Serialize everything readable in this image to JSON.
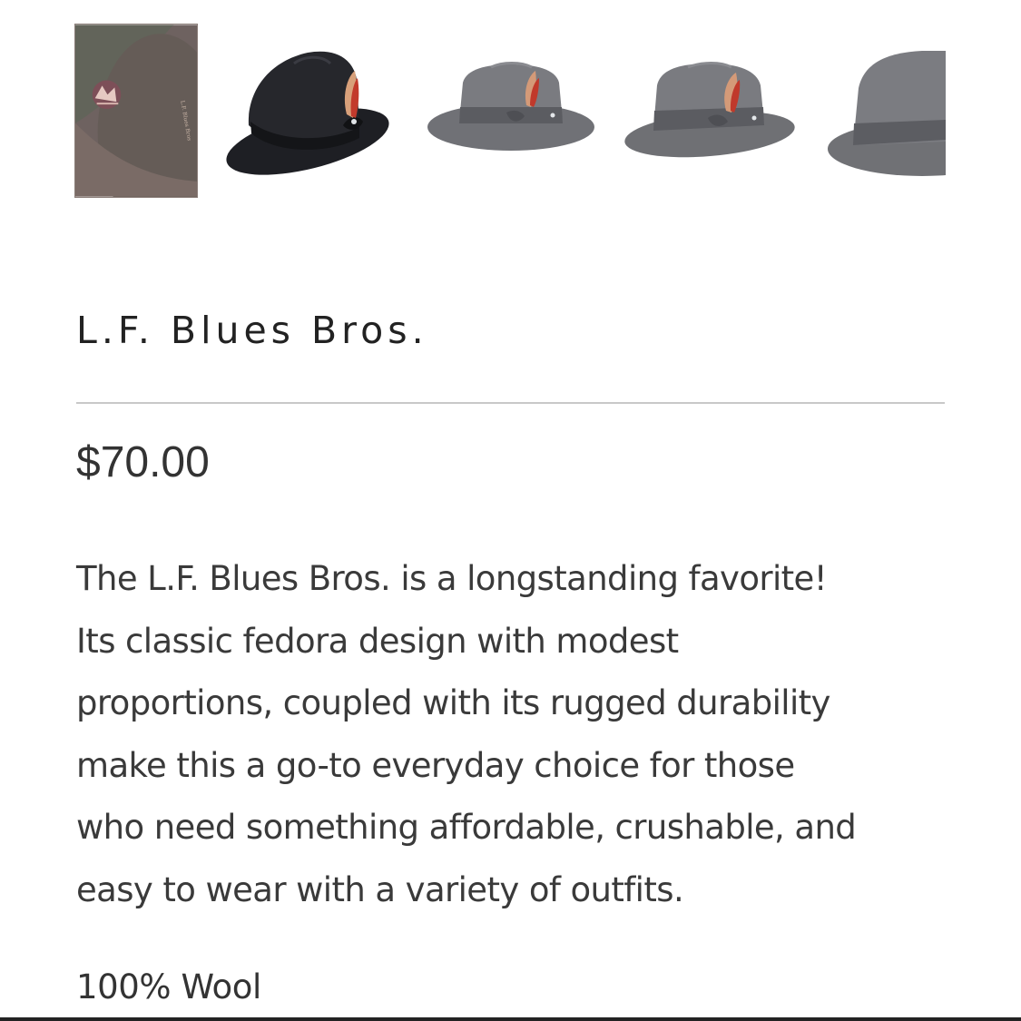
{
  "gallery": {
    "thumbnails": [
      {
        "icon": "hat-interior-label-photo",
        "bg": "#6e6260"
      },
      {
        "icon": "black-fedora-photo",
        "bg": "#1e1f24"
      },
      {
        "icon": "grey-fedora-front-photo",
        "bg": "#707176"
      },
      {
        "icon": "grey-fedora-side-photo",
        "bg": "#6f7074"
      },
      {
        "icon": "grey-fedora-cropped-photo",
        "bg": "#707175"
      }
    ]
  },
  "product": {
    "title": "L.F. Blues Bros.",
    "price": "$70.00",
    "description_lines": [
      "The L.F. Blues Bros. is a longstanding favorite!",
      "Its classic fedora design with modest",
      "proportions, coupled with its rugged durability",
      "make this a go-to everyday choice for those",
      "who need something affordable, crushable, and",
      "easy to wear with a variety of outfits."
    ],
    "material": "100% Wool"
  }
}
